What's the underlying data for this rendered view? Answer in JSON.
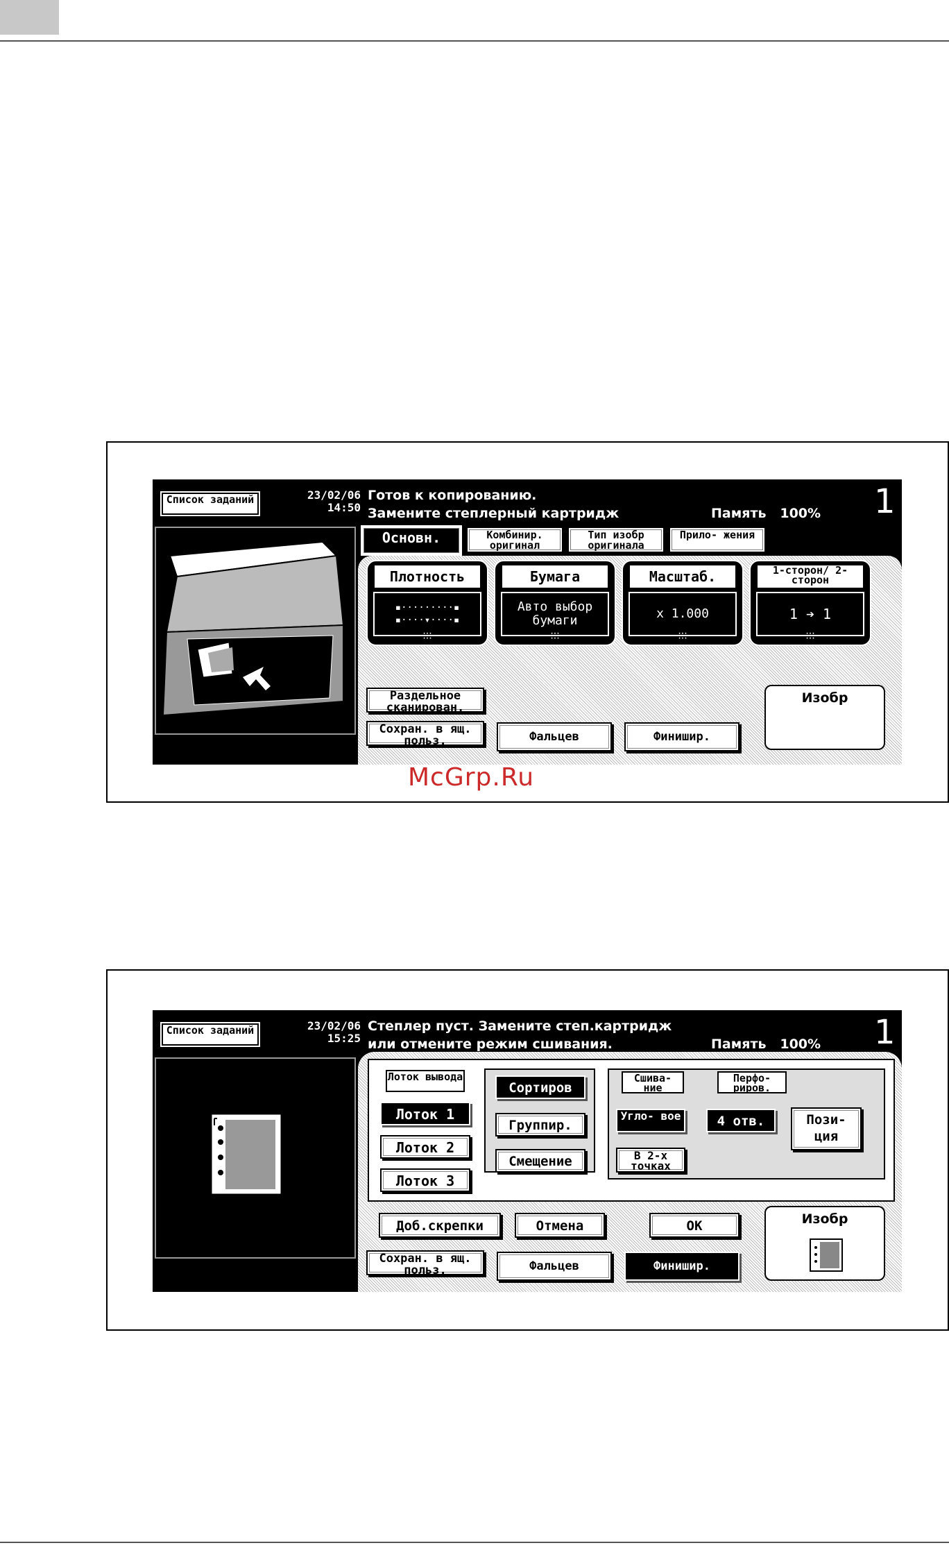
{
  "panel1": {
    "job_list_label": "Список заданий",
    "date": "23/02/06",
    "time": "14:50",
    "message_line1": "Готов к копированию.",
    "message_line2": "Замените степлерный картридж",
    "memory_label": "Память",
    "memory_value": "100%",
    "copy_count": "1",
    "tabs": [
      "Основн.",
      "Комбинир. оригинал",
      "Тип изобр оригинала",
      "Прило- жения"
    ],
    "cards": [
      {
        "title": "Плотность",
        "value": ""
      },
      {
        "title": "Бумага",
        "value": "Авто выбор бумаги"
      },
      {
        "title": "Масштаб.",
        "value": "x 1.000"
      },
      {
        "title": "1-сторон/ 2-сторон",
        "value": "1 ➔ 1"
      }
    ],
    "buttons": {
      "separate_scan": "Раздельное сканирован.",
      "save_user_box": "Сохран. в ящ. польз.",
      "fold": "Фальцев",
      "finish": "Финишир."
    },
    "image_label": "Изобр"
  },
  "watermark": "McGrp.Ru",
  "panel2": {
    "job_list_label": "Список заданий",
    "date": "23/02/06",
    "time": "15:25",
    "message_line1": "Степлер пуст. Замените степ.картридж",
    "message_line2": "или отмените режим сшивания.",
    "memory_label": "Память",
    "memory_value": "100%",
    "copy_count": "1",
    "output_tray_label": "Лоток вывода",
    "trays": [
      "Лоток 1",
      "Лоток 2",
      "Лоток 3"
    ],
    "sort": "Сортиров",
    "group": "Группир.",
    "offset": "Смещение",
    "staple_label": "Сшива- ние",
    "staple_corner": "Угло- вое",
    "staple_two": "В 2-х точках",
    "punch_label": "Перфо- риров.",
    "punch_value": "4 отв.",
    "position": "Пози- ция",
    "add_staples": "Доб.скрепки",
    "cancel": "Отмена",
    "ok": "OK",
    "save_user_box": "Сохран. в ящ. польз.",
    "fold": "Фальцев",
    "finish": "Финишир.",
    "image_label": "Изобр"
  }
}
